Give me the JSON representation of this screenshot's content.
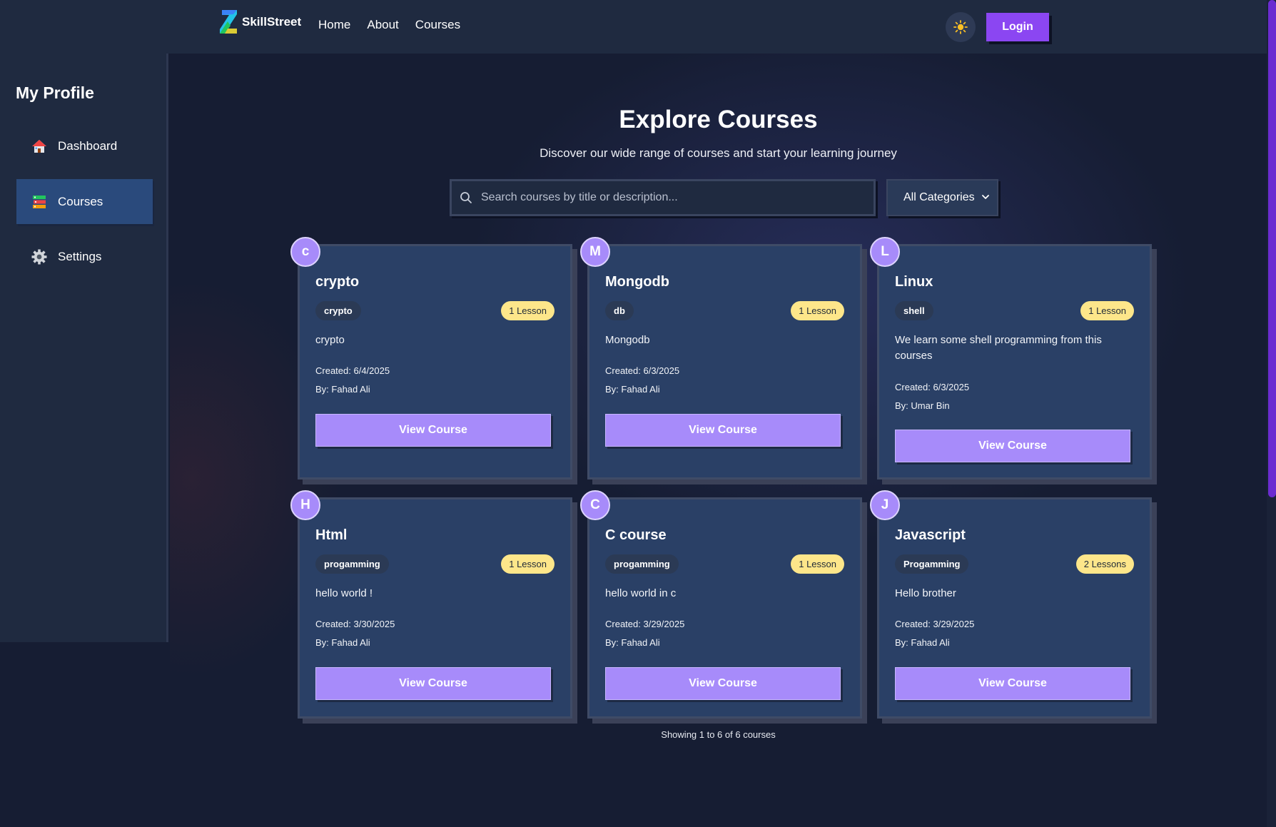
{
  "app": {
    "brand": "SkillStreet",
    "nav": [
      "Home",
      "About",
      "Courses"
    ],
    "login_label": "Login",
    "accent_color": "#8b46f2",
    "theme_icon": "sun-icon"
  },
  "sidebar": {
    "title": "My Profile",
    "items": [
      {
        "label": "Dashboard",
        "icon": "house-icon",
        "active": false
      },
      {
        "label": "Courses",
        "icon": "books-icon",
        "active": true
      },
      {
        "label": "Settings",
        "icon": "gear-icon",
        "active": false
      }
    ]
  },
  "main": {
    "title": "Explore Courses",
    "subtitle": "Discover our wide range of courses and start your learning journey",
    "search_placeholder": "Search courses by title or description...",
    "category_selected": "All Categories",
    "courses": [
      {
        "initial": "c",
        "title": "crypto",
        "tag": "crypto",
        "lessons": "1 Lesson",
        "description": "crypto",
        "created": "Created: 6/4/2025",
        "author": "By: Fahad Ali",
        "button": "View Course"
      },
      {
        "initial": "M",
        "title": "Mongodb",
        "tag": "db",
        "lessons": "1 Lesson",
        "description": "Mongodb",
        "created": "Created: 6/3/2025",
        "author": "By: Fahad Ali",
        "button": "View Course"
      },
      {
        "initial": "L",
        "title": "Linux",
        "tag": "shell",
        "lessons": "1 Lesson",
        "description": "We learn some shell programming from this courses",
        "created": "Created: 6/3/2025",
        "author": "By: Umar Bin",
        "button": "View Course"
      },
      {
        "initial": "H",
        "title": "Html",
        "tag": "progamming",
        "lessons": "1 Lesson",
        "description": "hello world !",
        "created": "Created: 3/30/2025",
        "author": "By: Fahad Ali",
        "button": "View Course"
      },
      {
        "initial": "C",
        "title": "C course",
        "tag": "progamming",
        "lessons": "1 Lesson",
        "description": "hello world in c",
        "created": "Created: 3/29/2025",
        "author": "By: Fahad Ali",
        "button": "View Course"
      },
      {
        "initial": "J",
        "title": "Javascript",
        "tag": "Progamming",
        "lessons": "2 Lessons",
        "description": "Hello brother",
        "created": "Created: 3/29/2025",
        "author": "By: Fahad Ali",
        "button": "View Course"
      }
    ],
    "pagination_text": "Showing 1 to 6 of 6 courses"
  }
}
